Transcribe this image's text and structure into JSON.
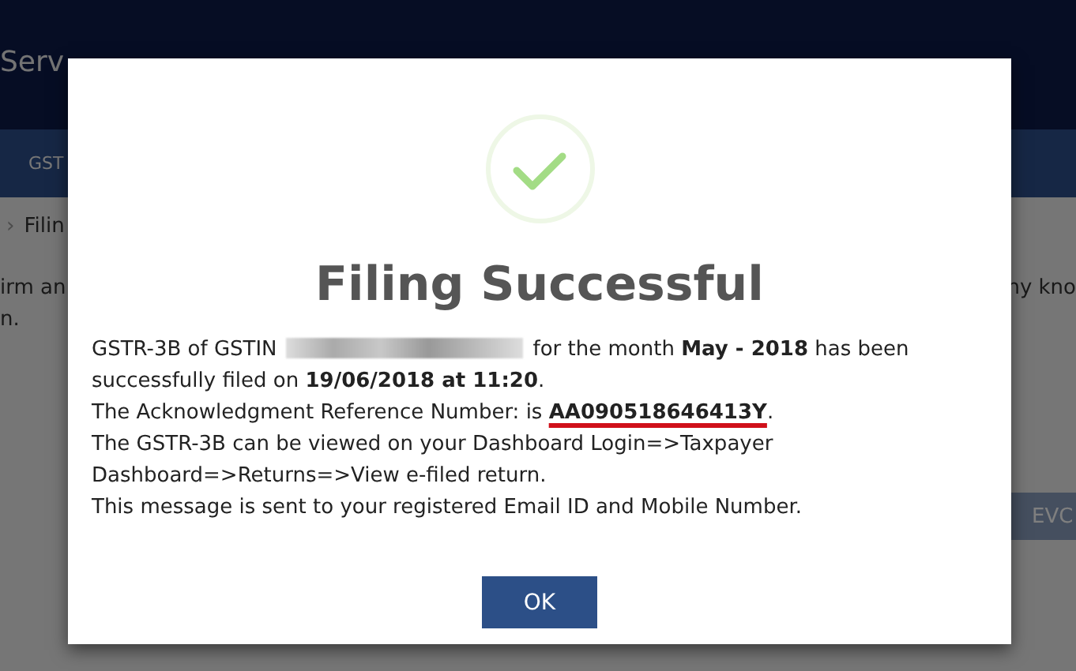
{
  "background": {
    "header_title": "Serv",
    "nav_item": "GST",
    "breadcrumb_separator": "›",
    "breadcrumb": "Filin",
    "text_left": [
      "irm an",
      "n."
    ],
    "text_right": "ny kno",
    "button": "EVC"
  },
  "dialog": {
    "title": "Filing Successful",
    "paragraphs": [
      [
        {
          "kind": "text",
          "text": "GSTR-3B of GSTIN"
        },
        {
          "kind": "redacted"
        },
        {
          "kind": "text",
          "text": "for the month **May - 2018** has been"
        }
      ],
      [
        {
          "kind": "text",
          "text": "successfully filed on **19/06/2018 at 11:20**."
        }
      ],
      [
        {
          "kind": "text",
          "text": "The Acknowledgment Reference Number: is "
        },
        {
          "kind": "marked",
          "text": "AA090518646413Y"
        },
        {
          "kind": "text",
          "text": "."
        }
      ],
      [
        {
          "kind": "text",
          "text": "The GSTR-3B can be viewed on your Dashboard Login=>Taxpayer"
        }
      ],
      [
        {
          "kind": "text",
          "text": "Dashboard=>Returns=>View e-filed return."
        }
      ],
      [
        {
          "kind": "text",
          "text": "This message is sent to your registered Email ID and Mobile Number."
        }
      ]
    ],
    "button": "OK"
  }
}
